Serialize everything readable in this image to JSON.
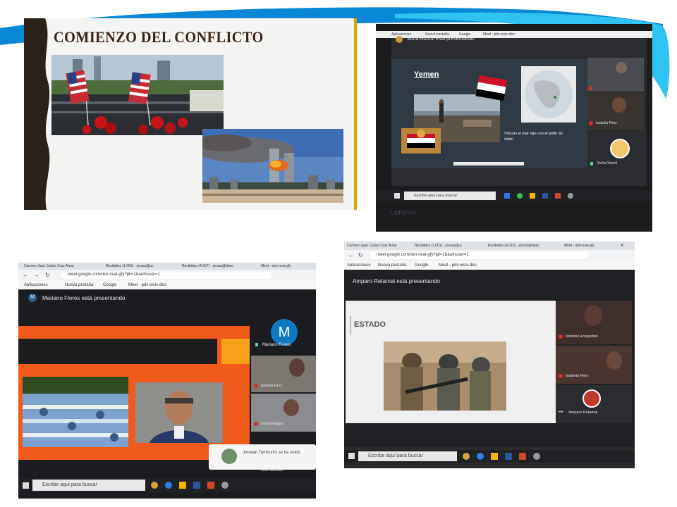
{
  "slide": {
    "title": "COMIENZO DEL CONFLICTO"
  },
  "photo2": {
    "presenter_banner": "Sofía Rizzoli está presentando",
    "bookmarks": [
      "Aplicaciones",
      "Nueva pestaña",
      "Google",
      "Meet - pdv-wsix-dko"
    ],
    "slide_title": "Yemen",
    "slide_caption": "Vinculo el mar rojo con el golfo de Adén",
    "participants": [
      "Isabella Fierz",
      "Sofía Rizzoli"
    ],
    "taskbar_search": "Escribe aquí para buscar",
    "monitor_brand": "Lenovo"
  },
  "photo3": {
    "tabs": [
      "Carmen Juan Carlos Cruz Amar",
      "Recibidos (1.061) - jcruza@uc",
      "Recibidos (4.007) - jcruza@duoc",
      "Meet - okn-nvai-gfy"
    ],
    "url": "meet.google.com/okn-nvai-gfy?pli=1&authuser=1",
    "bookmarks": [
      "Aplicaciones",
      "Nueva pestaña",
      "Google",
      "Meet - pdv-wsix-dko"
    ],
    "presenter_banner": "Mariano Flores está presentando",
    "avatar_letter": "M",
    "participants": [
      "Mariano Flores",
      "Isabella Fierz",
      "Isidora Rogers",
      "Jose Martinez"
    ],
    "notification": "Jonatan Tamburini se ha unido",
    "taskbar_search": "Escribe aquí para buscar"
  },
  "photo4": {
    "tabs": [
      "Carmen Juan Carlos Cruz Amar",
      "Recibidos (1.061) - jcruza@uc",
      "Recibidos (4.010) - jcruza@duoc",
      "Meet - okn-nvai-gfy"
    ],
    "url": "meet.google.com/okn-nvai-gfy?pli=1&authuser=1",
    "bookmarks": [
      "Aplicaciones",
      "Nueva pestaña",
      "Google",
      "Meet - pdv-wsix-dko"
    ],
    "presenter_banner": "Amparo Retamal está presentando",
    "slide_title": "ESTADO",
    "participants": [
      "Isidora Larraguibel",
      "Isabella Fierz",
      "Amparo Retamal"
    ],
    "taskbar_search": "Escribe aquí para buscar"
  },
  "colors": {
    "swoosh_dark": "#0a88d6",
    "swoosh_light": "#2fc3f2",
    "meet_dark": "#202124",
    "mic_off": "#d93025",
    "slide_orange": "#f05a1a"
  }
}
